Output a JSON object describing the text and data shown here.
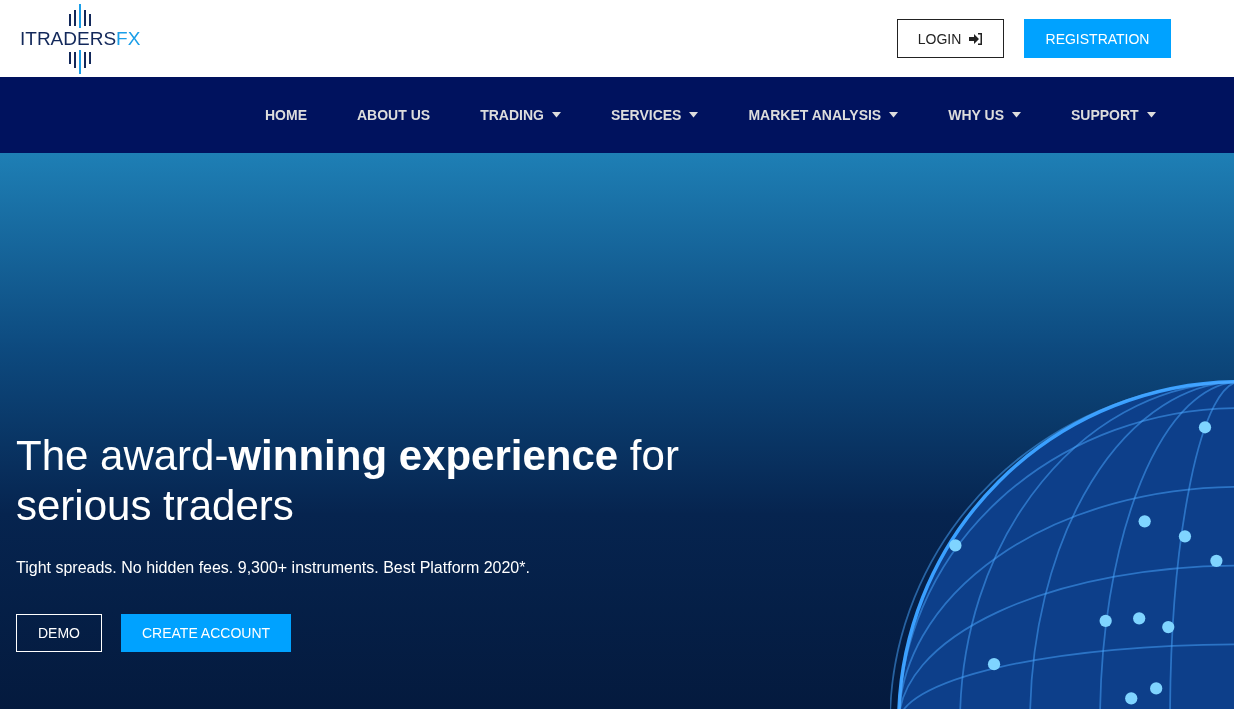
{
  "header": {
    "logo": {
      "main": "ITRADERS",
      "accent": "FX"
    },
    "login": "LOGIN",
    "registration": "REGISTRATION"
  },
  "nav": [
    {
      "label": "HOME",
      "dropdown": false
    },
    {
      "label": "ABOUT US",
      "dropdown": false
    },
    {
      "label": "TRADING",
      "dropdown": true
    },
    {
      "label": "SERVICES",
      "dropdown": true
    },
    {
      "label": "MARKET ANALYSIS",
      "dropdown": true
    },
    {
      "label": "WHY US",
      "dropdown": true
    },
    {
      "label": "SUPPORT",
      "dropdown": true
    }
  ],
  "hero": {
    "headline": "The award-**winning experience** for serious traders",
    "subtitle": "Tight spreads. No hidden fees. 9,300+ instruments. Best Platform 2020*.",
    "buttons": [
      {
        "label": "DEMO",
        "kind": "outline"
      },
      {
        "label": "CREATE ACCOUNT",
        "kind": "filled"
      }
    ]
  }
}
